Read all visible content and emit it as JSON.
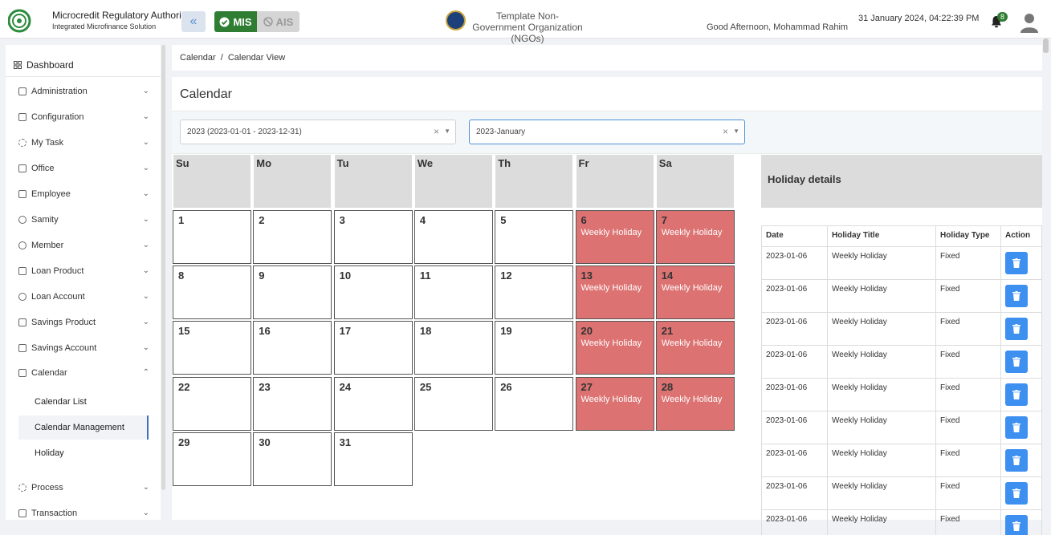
{
  "header": {
    "org_title": "Microcredit Regulatory Authority",
    "org_subtitle": "Integrated Microfinance Solution",
    "logo_text": "Microcredit Regulatory Authority",
    "mis_label": "MIS",
    "ais_label": "AIS",
    "ngo_name": "Template Non-Government Organization (NGOs)",
    "greeting": "Good Afternoon, Mohammad Rahim",
    "datetime": "31 January 2024, 04:22:39 PM",
    "notification_count": "8"
  },
  "sidebar": {
    "dashboard": "Dashboard",
    "items": [
      {
        "label": "Administration"
      },
      {
        "label": "Configuration"
      },
      {
        "label": "My Task"
      },
      {
        "label": "Office"
      },
      {
        "label": "Employee"
      },
      {
        "label": "Samity"
      },
      {
        "label": "Member"
      },
      {
        "label": "Loan Product"
      },
      {
        "label": "Loan Account"
      },
      {
        "label": "Savings Product"
      },
      {
        "label": "Savings Account"
      },
      {
        "label": "Calendar"
      }
    ],
    "calendar_sub": [
      "Calendar List",
      "Calendar Management",
      "Holiday"
    ],
    "items_after": [
      {
        "label": "Process"
      },
      {
        "label": "Transaction"
      }
    ]
  },
  "breadcrumb": {
    "root": "Calendar",
    "separator": "/",
    "current": "Calendar View"
  },
  "page": {
    "title": "Calendar",
    "year_select": "2023 (2023-01-01 - 2023-12-31)",
    "month_select": "2023-January"
  },
  "calendar": {
    "weekdays": [
      "Su",
      "Mo",
      "Tu",
      "We",
      "Th",
      "Fr",
      "Sa"
    ],
    "holiday_label": "Weekly Holiday",
    "rows": [
      [
        {
          "d": "1"
        },
        {
          "d": "2"
        },
        {
          "d": "3"
        },
        {
          "d": "4"
        },
        {
          "d": "5"
        },
        {
          "d": "6",
          "h": true
        },
        {
          "d": "7",
          "h": true
        }
      ],
      [
        {
          "d": "8"
        },
        {
          "d": "9"
        },
        {
          "d": "10"
        },
        {
          "d": "11"
        },
        {
          "d": "12"
        },
        {
          "d": "13",
          "h": true
        },
        {
          "d": "14",
          "h": true
        }
      ],
      [
        {
          "d": "15"
        },
        {
          "d": "16"
        },
        {
          "d": "17"
        },
        {
          "d": "18"
        },
        {
          "d": "19"
        },
        {
          "d": "20",
          "h": true
        },
        {
          "d": "21",
          "h": true
        }
      ],
      [
        {
          "d": "22"
        },
        {
          "d": "23"
        },
        {
          "d": "24"
        },
        {
          "d": "25"
        },
        {
          "d": "26"
        },
        {
          "d": "27",
          "h": true
        },
        {
          "d": "28",
          "h": true
        }
      ],
      [
        {
          "d": "29"
        },
        {
          "d": "30"
        },
        {
          "d": "31"
        }
      ]
    ]
  },
  "holiday_details": {
    "title": "Holiday details",
    "columns": [
      "Date",
      "Holiday Title",
      "Holiday Type",
      "Action"
    ],
    "rows": [
      [
        "2023-01-06",
        "Weekly Holiday",
        "Fixed"
      ],
      [
        "2023-01-06",
        "Weekly Holiday",
        "Fixed"
      ],
      [
        "2023-01-06",
        "Weekly Holiday",
        "Fixed"
      ],
      [
        "2023-01-06",
        "Weekly Holiday",
        "Fixed"
      ],
      [
        "2023-01-06",
        "Weekly Holiday",
        "Fixed"
      ],
      [
        "2023-01-06",
        "Weekly Holiday",
        "Fixed"
      ],
      [
        "2023-01-06",
        "Weekly Holiday",
        "Fixed"
      ],
      [
        "2023-01-06",
        "Weekly Holiday",
        "Fixed"
      ],
      [
        "2023-01-06",
        "Weekly Holiday",
        "Fixed"
      ]
    ]
  },
  "colors": {
    "holiday": "#dd7272",
    "mis_green": "#2e7d32",
    "delete_blue": "#3d8ff0"
  }
}
